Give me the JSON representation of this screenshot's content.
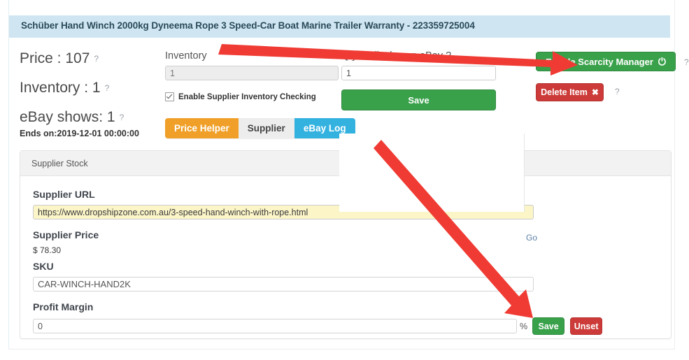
{
  "header": {
    "title": "Schüber Hand Winch 2000kg Dyneema Rope 3 Speed-Car Boat Marine Trailer Warranty - 223359725004"
  },
  "summary": {
    "price_line": "Price : 107",
    "inventory_line": "Inventory : 1",
    "ebay_shows_line": "eBay shows: 1",
    "ends_on": "Ends on:2019-12-01 00:00:00",
    "help_marker": "?"
  },
  "inventory_field": {
    "label": "Inventory",
    "value": "1"
  },
  "supplier_check": {
    "label": "Enable Supplier Inventory Checking",
    "checked": true
  },
  "qty_field": {
    "label": "Qty to display on eBay",
    "help_marker": "?",
    "value": "1"
  },
  "save_main": {
    "label": "Save"
  },
  "scarcity": {
    "label": "Enable Scarcity Manager",
    "icon": "power-icon",
    "glyph": "⏻",
    "help_marker": "?"
  },
  "delete_item": {
    "label": "Delete Item",
    "icon": "close-x-icon",
    "glyph": "✖",
    "help_marker": "?"
  },
  "tabs": [
    {
      "label": "Price Helper",
      "state": "active-orange"
    },
    {
      "label": "Supplier",
      "state": "inactive-white"
    },
    {
      "label": "eBay Log",
      "state": "blue"
    }
  ],
  "panel": {
    "header": "Supplier Stock",
    "supplier_url": {
      "label": "Supplier URL",
      "value": "https://www.dropshipzone.com.au/3-speed-hand-winch-with-rope.html",
      "go_label": "Go"
    },
    "supplier_price": {
      "label": "Supplier Price",
      "value": "$ 78.30"
    },
    "sku": {
      "label": "SKU",
      "value": "CAR-WINCH-HAND2K"
    },
    "profit_margin": {
      "label": "Profit Margin",
      "value": "0",
      "unit": "%",
      "save_label": "Save",
      "unset_label": "Unset"
    }
  },
  "colors": {
    "title_bar": "#cfe6f2",
    "green": "#3aa14b",
    "red": "#cc3b39",
    "orange": "#f0a028",
    "blue": "#33b2e0",
    "autofill_yellow": "#fbf5c8",
    "annotation_red": "#ef3b33"
  }
}
